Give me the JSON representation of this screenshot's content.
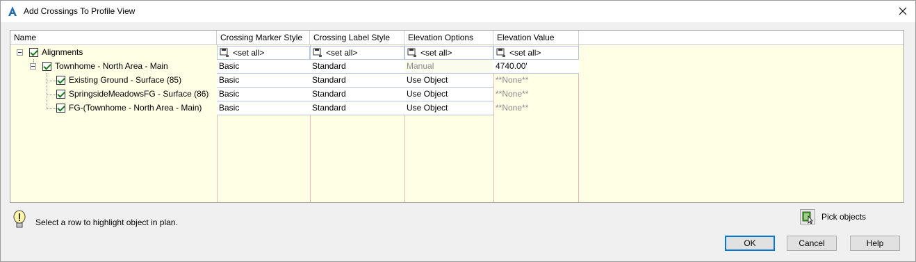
{
  "window": {
    "title": "Add Crossings To Profile View",
    "close_icon": "close-icon",
    "app_icon": "autocad-civil-icon"
  },
  "grid": {
    "columns": [
      "Name",
      "Crossing Marker Style",
      "Crossing Label Style",
      "Elevation Options",
      "Elevation Value"
    ],
    "root": {
      "label": "Alignments",
      "checked": true,
      "marker": "<set all>",
      "label_style": "<set all>",
      "elev_option": "<set all>",
      "elev_value": "<set all>"
    },
    "alignment": {
      "label": "Townhome - North Area - Main",
      "checked": true,
      "marker": "Basic",
      "label_style": "Standard",
      "elev_option": "Manual",
      "elev_value": "4740.00'"
    },
    "rows": [
      {
        "label": "Existing Ground - Surface (85)",
        "checked": true,
        "marker": "Basic",
        "label_style": "Standard",
        "elev_option": "Use Object",
        "elev_value": "**None**"
      },
      {
        "label": "SpringsideMeadowsFG - Surface (86)",
        "checked": true,
        "marker": "Basic",
        "label_style": "Standard",
        "elev_option": "Use Object",
        "elev_value": "**None**"
      },
      {
        "label": "FG-(Townhome - North Area - Main)",
        "checked": true,
        "marker": "Basic",
        "label_style": "Standard",
        "elev_option": "Use Object",
        "elev_value": "**None**"
      }
    ]
  },
  "footer": {
    "hint": "Select a row to highlight object in plan.",
    "pick_label": "Pick objects",
    "ok": "OK",
    "cancel": "Cancel",
    "help": "Help"
  }
}
